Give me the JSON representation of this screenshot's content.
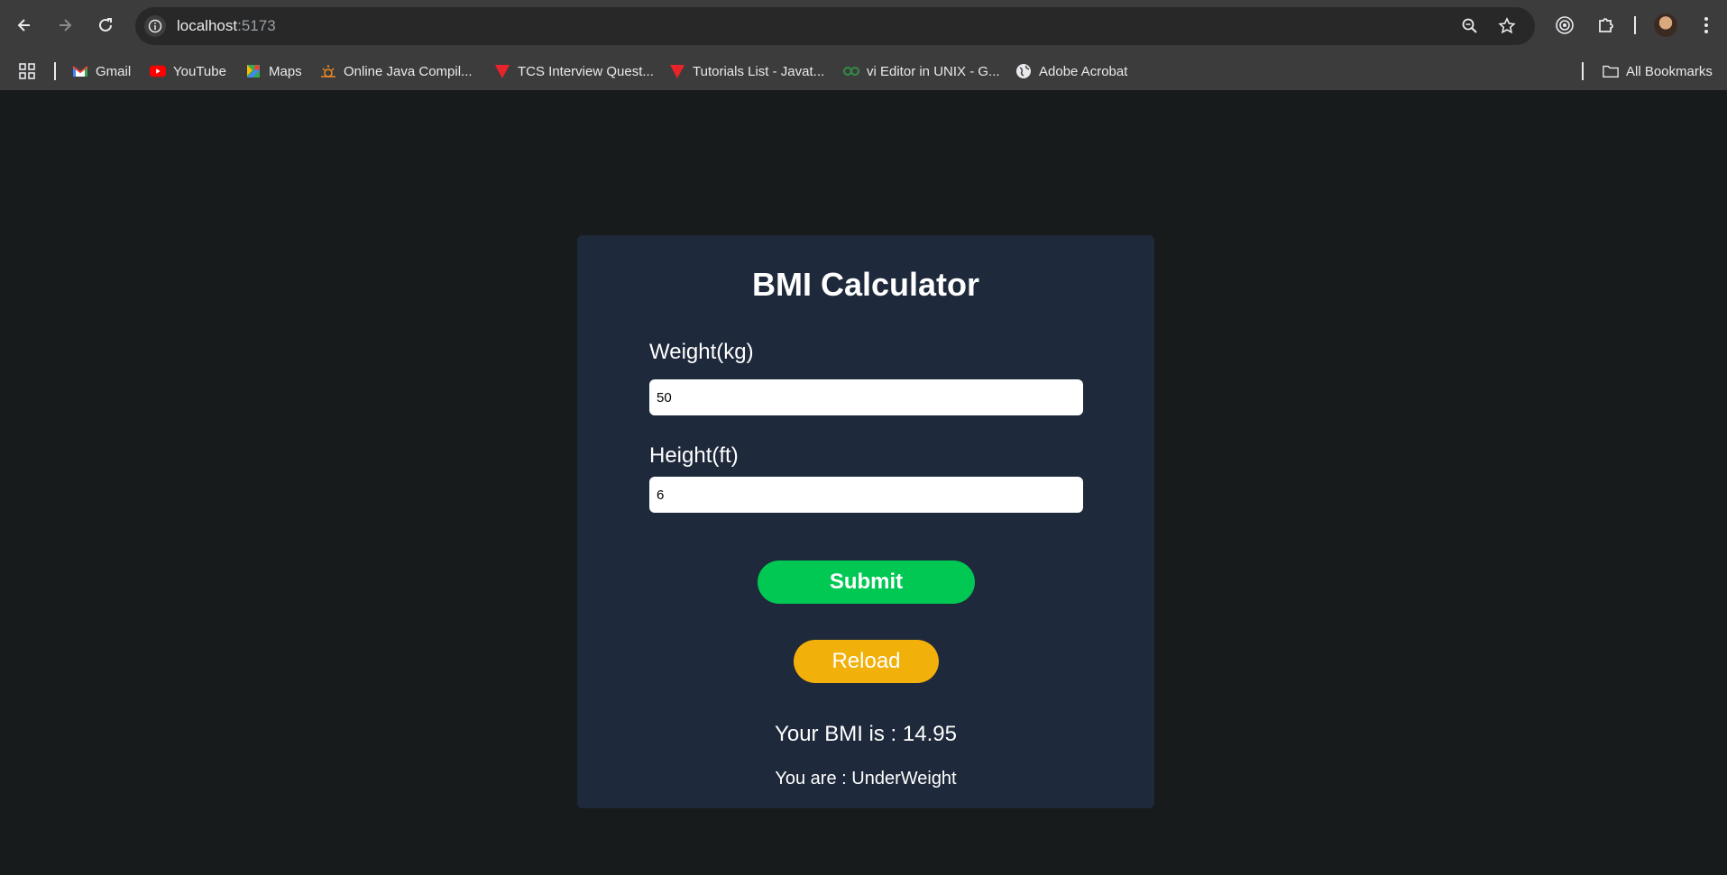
{
  "browser": {
    "url_host": "localhost",
    "url_port": ":5173",
    "icons": [
      "back-icon",
      "forward-icon",
      "reload-icon",
      "site-info-icon",
      "zoom-icon",
      "star-icon",
      "extension-circle-icon",
      "puzzle-icon",
      "avatar",
      "kebab-menu-icon"
    ]
  },
  "bookmarks": {
    "items": [
      {
        "label": "Gmail",
        "icon": "gmail-icon"
      },
      {
        "label": "YouTube",
        "icon": "youtube-icon"
      },
      {
        "label": "Maps",
        "icon": "maps-icon"
      },
      {
        "label": "Online Java Compil...",
        "icon": "java-icon"
      },
      {
        "label": "TCS Interview Quest...",
        "icon": "triangle-icon"
      },
      {
        "label": "Tutorials List - Javat...",
        "icon": "triangle-icon"
      },
      {
        "label": "vi Editor in UNIX - G...",
        "icon": "gfg-icon"
      },
      {
        "label": "Adobe Acrobat",
        "icon": "globe-icon"
      }
    ],
    "all_bookmarks_label": "All Bookmarks"
  },
  "app": {
    "title": "BMI Calculator",
    "weight_label": "Weight(kg)",
    "weight_value": "50",
    "height_label": "Height(ft)",
    "height_value": "6",
    "submit_label": "Submit",
    "reload_label": "Reload",
    "bmi_text": "Your BMI is : 14.95",
    "status_text": "You are : UnderWeight"
  },
  "colors": {
    "page_bg": "#181b1c",
    "card_bg": "#1e293b",
    "submit": "#00c853",
    "reload": "#f2b00a"
  }
}
